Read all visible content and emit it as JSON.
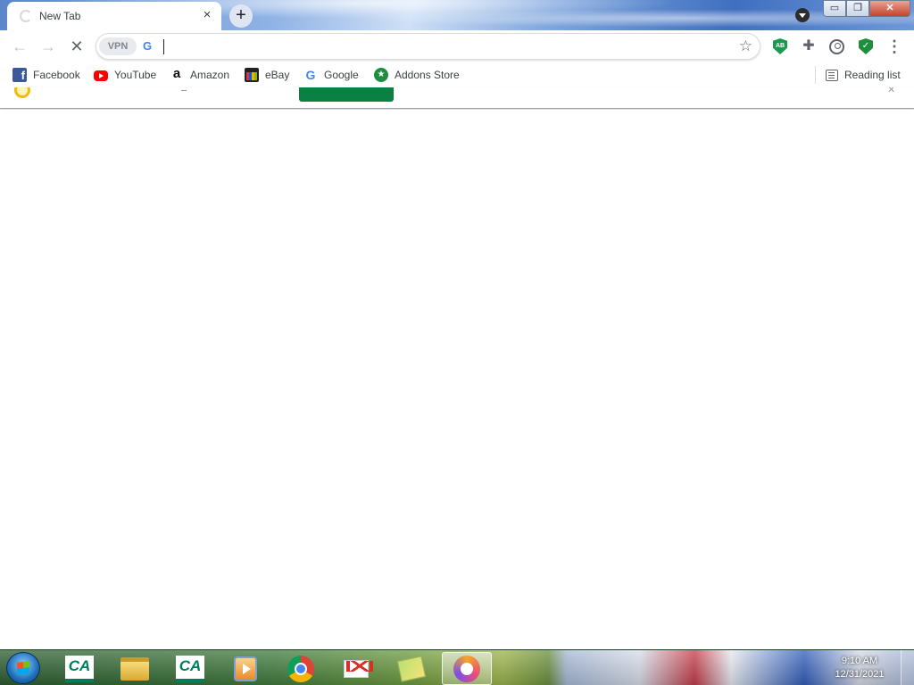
{
  "window": {
    "tab": {
      "title": "New Tab",
      "close_glyph": "×",
      "favicon": "loading-spinner-icon"
    },
    "new_tab_glyph": "+",
    "controls": {
      "minimize_glyph": "▭",
      "restore_glyph": "❐",
      "close_glyph": "✕"
    }
  },
  "toolbar": {
    "back_glyph": "←",
    "forward_glyph": "→",
    "stop_glyph": "✕",
    "vpn_label": "VPN",
    "search_engine_glyph": "G",
    "address_value": "",
    "address_placeholder": "",
    "bookmark_star_glyph": "☆",
    "extensions": [
      {
        "name": "adblock",
        "label": "AB"
      },
      {
        "name": "puzzle",
        "glyph": "✚"
      },
      {
        "name": "profile",
        "glyph": ""
      },
      {
        "name": "shield",
        "glyph": "✓"
      }
    ],
    "menu_glyph": "⋮"
  },
  "bookmarks": [
    {
      "label": "Facebook",
      "icon": "facebook-icon",
      "glyph": "f"
    },
    {
      "label": "YouTube",
      "icon": "youtube-icon",
      "glyph": ""
    },
    {
      "label": "Amazon",
      "icon": "amazon-icon",
      "glyph": "a"
    },
    {
      "label": "eBay",
      "icon": "ebay-icon",
      "glyph": ""
    },
    {
      "label": "Google",
      "icon": "google-icon",
      "glyph": "G"
    },
    {
      "label": "Addons Store",
      "icon": "addons-store-icon",
      "glyph": "★"
    }
  ],
  "reading_list": {
    "label": "Reading list",
    "icon": "reading-list-icon"
  },
  "taskbar": {
    "apps": [
      {
        "name": "credit-agricole",
        "label": "CA"
      },
      {
        "name": "file-explorer",
        "label": ""
      },
      {
        "name": "credit-agricole-2",
        "label": "CA"
      },
      {
        "name": "media-player",
        "label": ""
      },
      {
        "name": "chrome",
        "label": ""
      },
      {
        "name": "gmail",
        "label": ""
      },
      {
        "name": "sticky-notes",
        "label": ""
      },
      {
        "name": "vpn-app",
        "label": ""
      }
    ],
    "clock": {
      "time": "9:10 AM",
      "date": "12/31/2021"
    }
  },
  "colors": {
    "accent_green": "#0b8043",
    "chrome_blue": "#4285f4",
    "taskbar_green": "#3f7a3c"
  }
}
